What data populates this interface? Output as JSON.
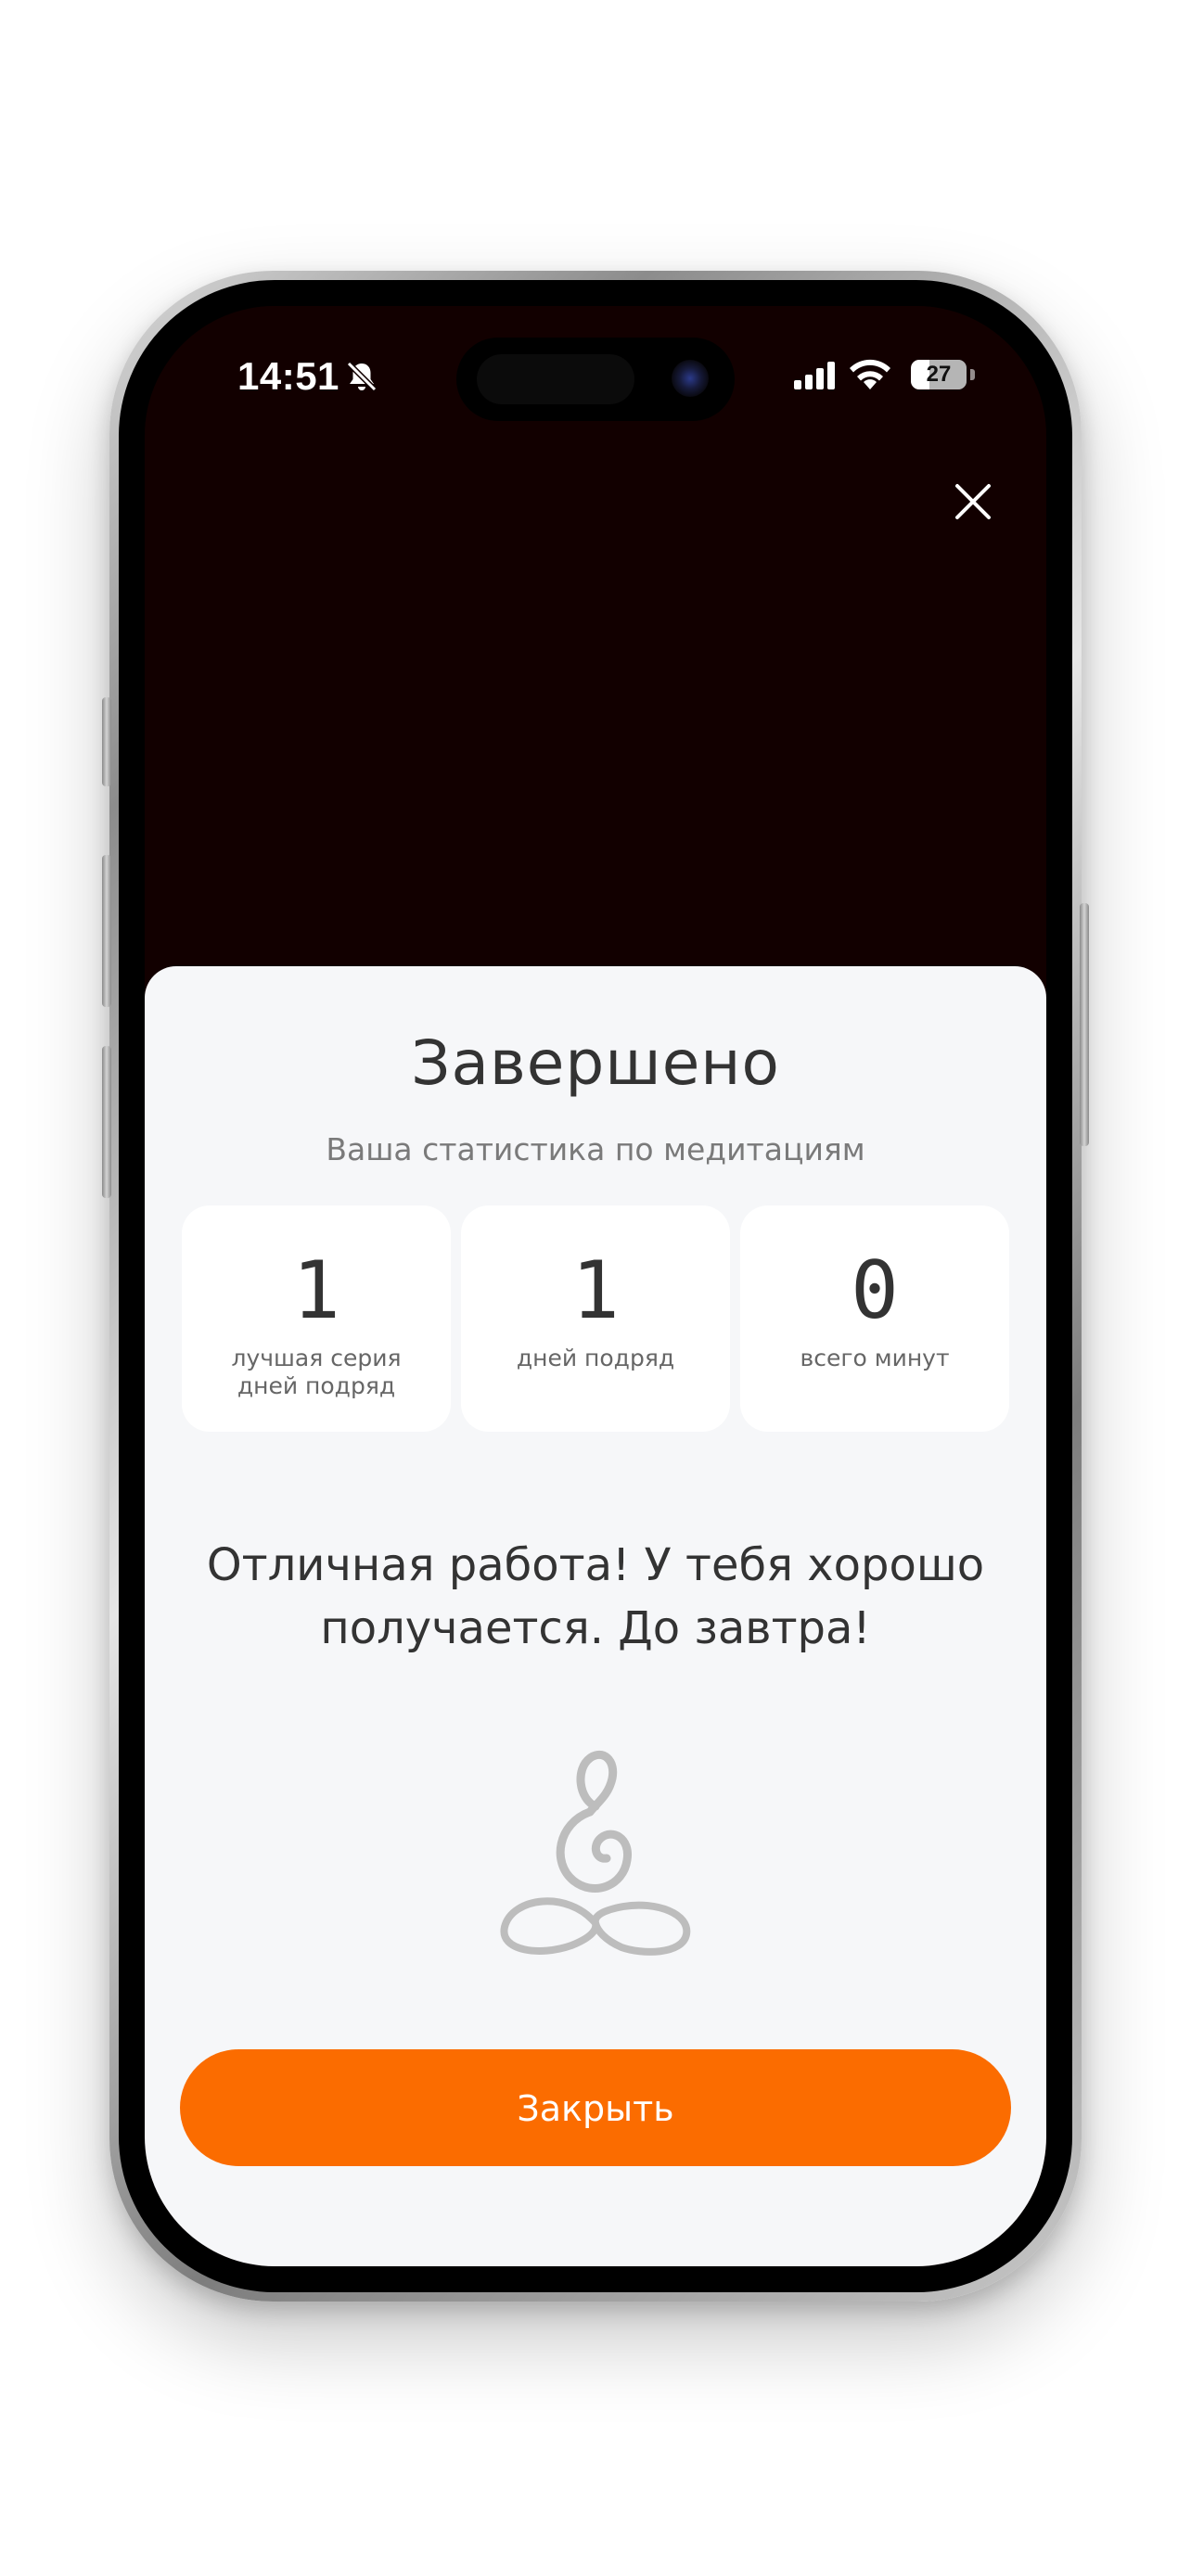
{
  "status_bar": {
    "time": "14:51",
    "battery_level": "27",
    "icons": [
      "bell-slash-icon",
      "cellular-signal-icon",
      "wifi-icon",
      "battery-icon"
    ]
  },
  "header": {
    "close_icon": "close-icon"
  },
  "sheet": {
    "title": "Завершено",
    "subtitle": "Ваша статистика по медитациям",
    "stats": [
      {
        "value": "1",
        "label": "лучшая серия\nдней подряд"
      },
      {
        "value": "1",
        "label": "дней подряд"
      },
      {
        "value": "0",
        "label": "всего минут"
      }
    ],
    "message": "Отличная работа! У тебя хорошо получается. До завтра!",
    "illustration_icon": "meditation-figure-icon",
    "close_button_label": "Закрыть"
  },
  "colors": {
    "accent": "#fb6c00",
    "sheet_background": "#f6f7f9",
    "text_primary": "#333333",
    "text_secondary": "#7a7a7a",
    "screen_background": "#120000"
  }
}
